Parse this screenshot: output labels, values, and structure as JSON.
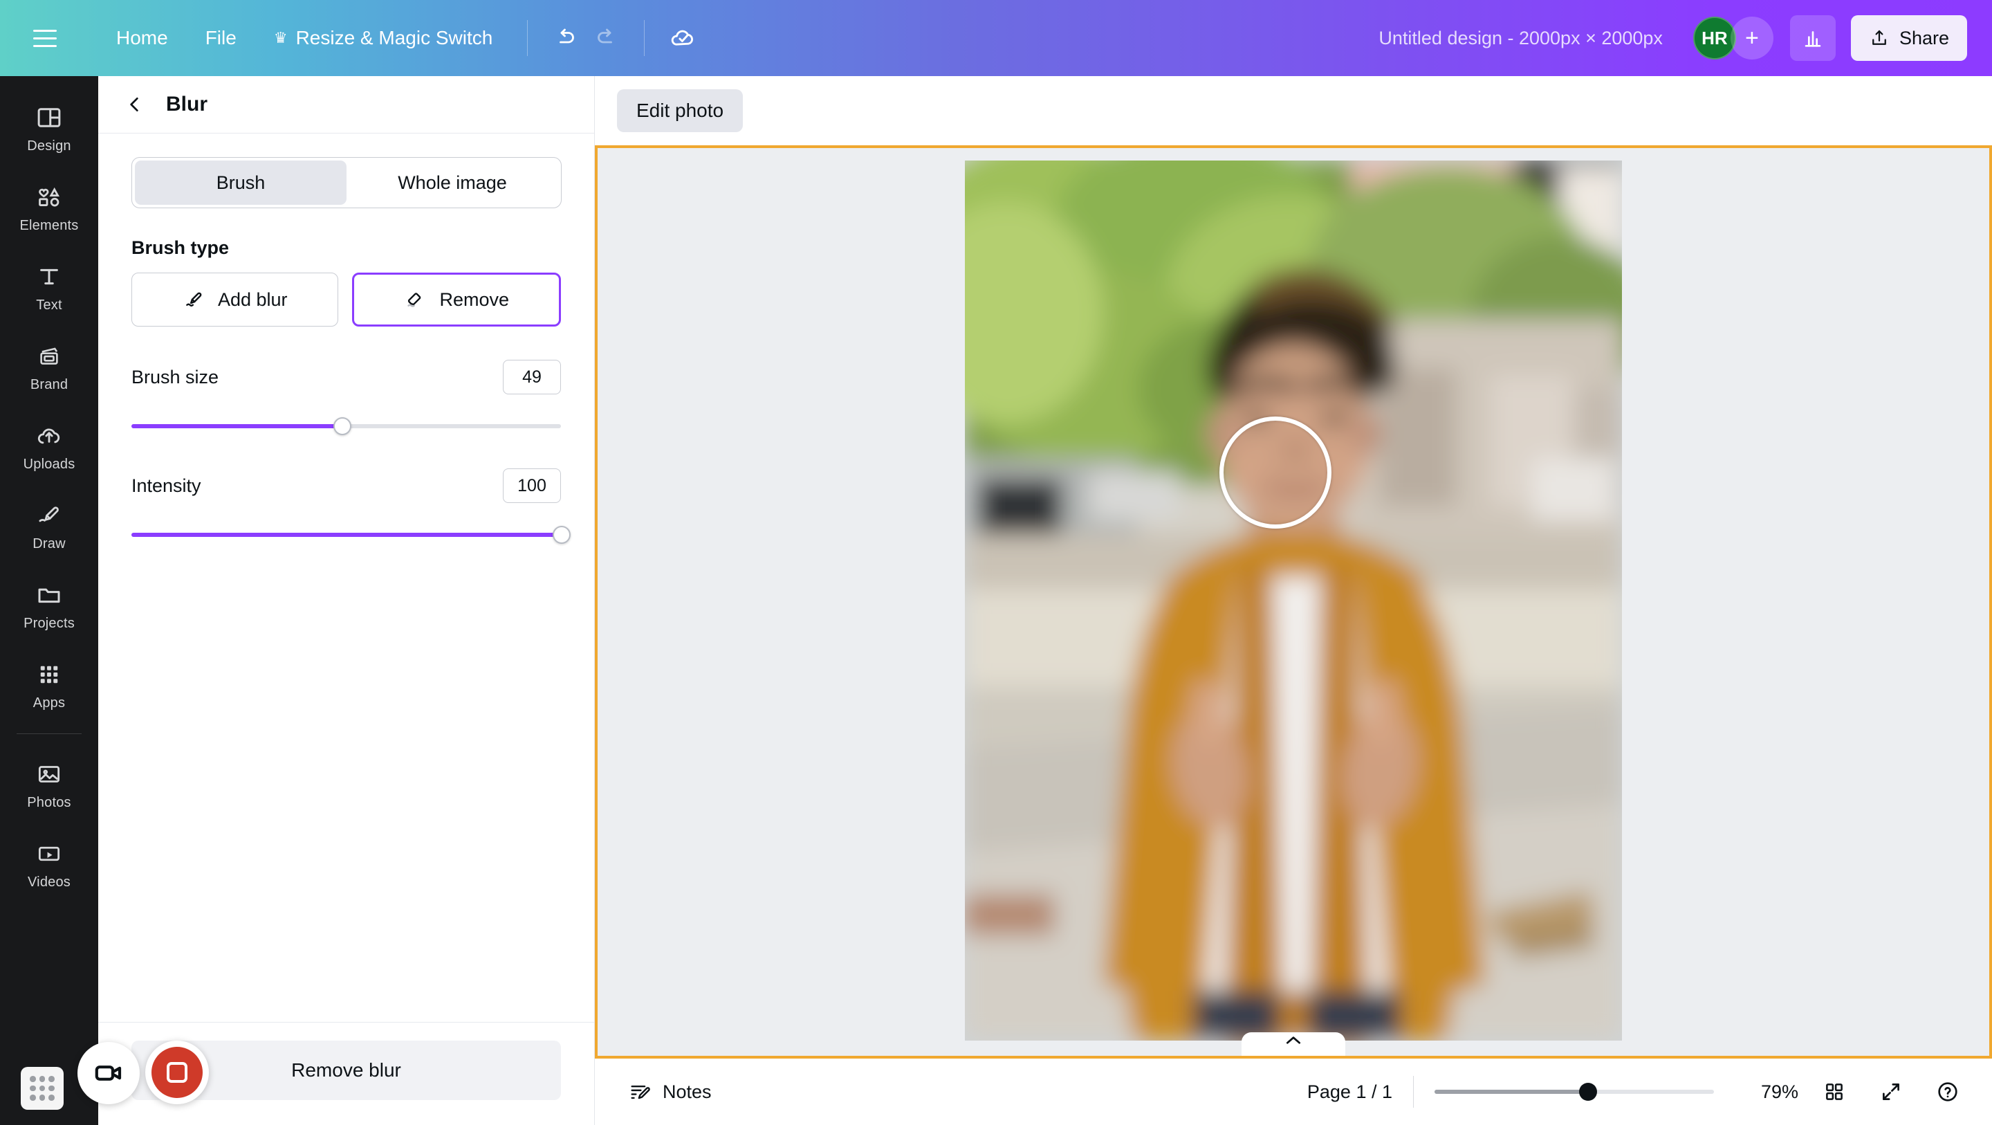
{
  "topbar": {
    "menu_icon": "hamburger-icon",
    "nav": [
      {
        "label": "Home",
        "icon": ""
      },
      {
        "label": "File",
        "icon": ""
      },
      {
        "label": "Resize & Magic Switch",
        "icon": "crown-icon"
      }
    ],
    "crown_glyph": "♛",
    "undo_icon": "undo-icon",
    "redo_icon": "redo-icon",
    "save_icon": "cloud-check-icon",
    "doc_title": "Untitled design - 2000px × 2000px",
    "avatar_initials": "HR",
    "avatar_color": "#0f7b30",
    "plus_label": "+",
    "analytics_icon": "bar-chart-icon",
    "share_label": "Share",
    "share_icon": "upload-icon"
  },
  "rail": {
    "items": [
      {
        "label": "Design",
        "icon": "layout-icon"
      },
      {
        "label": "Elements",
        "icon": "shapes-icon"
      },
      {
        "label": "Text",
        "icon": "text-icon"
      },
      {
        "label": "Brand",
        "icon": "brand-card-icon"
      },
      {
        "label": "Uploads",
        "icon": "cloud-upload-icon"
      },
      {
        "label": "Draw",
        "icon": "pen-icon"
      },
      {
        "label": "Projects",
        "icon": "folder-icon"
      },
      {
        "label": "Apps",
        "icon": "grid-apps-icon"
      }
    ],
    "items_after_sep": [
      {
        "label": "Photos",
        "icon": "image-icon"
      },
      {
        "label": "Videos",
        "icon": "video-icon"
      }
    ]
  },
  "panel": {
    "back_icon": "chevron-left-icon",
    "title": "Blur",
    "mode_tabs": [
      {
        "label": "Brush",
        "active": true
      },
      {
        "label": "Whole image",
        "active": false
      }
    ],
    "brush_type_title": "Brush type",
    "brush_types": [
      {
        "label": "Add blur",
        "icon": "pen-brush-icon",
        "selected": false
      },
      {
        "label": "Remove",
        "icon": "eraser-icon",
        "selected": true
      }
    ],
    "sliders": [
      {
        "label": "Brush size",
        "value": "49",
        "percent": 49
      },
      {
        "label": "Intensity",
        "value": "100",
        "percent": 100
      }
    ],
    "accent_color": "#8b3dff",
    "footer_button": "Remove blur"
  },
  "stage": {
    "edit_photo_label": "Edit photo",
    "canvas_border_color": "#f0a830",
    "collapse_icon": "chevron-up-icon",
    "brush_cursor": "brush-circle-cursor"
  },
  "bottombar": {
    "notes_label": "Notes",
    "notes_icon": "notes-pen-icon",
    "page_indicator": "Page 1 / 1",
    "zoom_percent": "79%",
    "zoom_slider_percent": 55,
    "grid_icon": "grid-view-icon",
    "fullscreen_icon": "expand-icon",
    "help_icon": "help-circle-icon"
  },
  "recorder": {
    "camera_icon": "video-camera-icon",
    "stop_icon": "stop-record-icon",
    "drag_icon": "drag-grid-icon"
  }
}
